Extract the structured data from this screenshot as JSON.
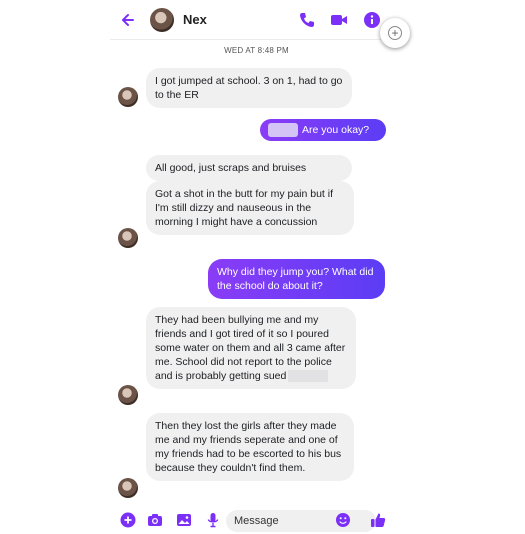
{
  "header": {
    "contact_name": "Nex",
    "icons": [
      "back-arrow-icon",
      "phone-icon",
      "video-icon",
      "info-icon"
    ]
  },
  "colors": {
    "accent": "#7b2ff7",
    "outgoing_gradient_start": "#8a3cf6",
    "outgoing_gradient_end": "#5b3df5",
    "incoming_bubble": "#f0f0f1"
  },
  "timestamp": "WED AT 8:48 PM",
  "messages": [
    {
      "sender": "them",
      "text": "I got jumped at school. 3 on 1, had to go to the ER"
    },
    {
      "sender": "me",
      "text": "Are you okay?"
    },
    {
      "sender": "them",
      "text": "All good, just scraps and bruises"
    },
    {
      "sender": "them",
      "text": "Got a shot in the butt for my pain but if I'm still dizzy and nauseous in the morning I might have a concussion"
    },
    {
      "sender": "me",
      "text": "Why did they jump you? What did the school do about it?"
    },
    {
      "sender": "them",
      "text": "They had been bullying me and my friends and I got tired of it so I poured some water on them and all 3 came after me. School did not report to the police and is probably getting sued"
    },
    {
      "sender": "them",
      "text": "Then they lost the girls after they made me and my friends seperate and one of my friends had to be escorted to his bus because they couldn't find them."
    }
  ],
  "composer": {
    "placeholder": "Message",
    "icons": [
      "plus-icon",
      "camera-icon",
      "gallery-icon",
      "mic-icon",
      "emoji-icon",
      "thumbs-up-icon"
    ]
  }
}
